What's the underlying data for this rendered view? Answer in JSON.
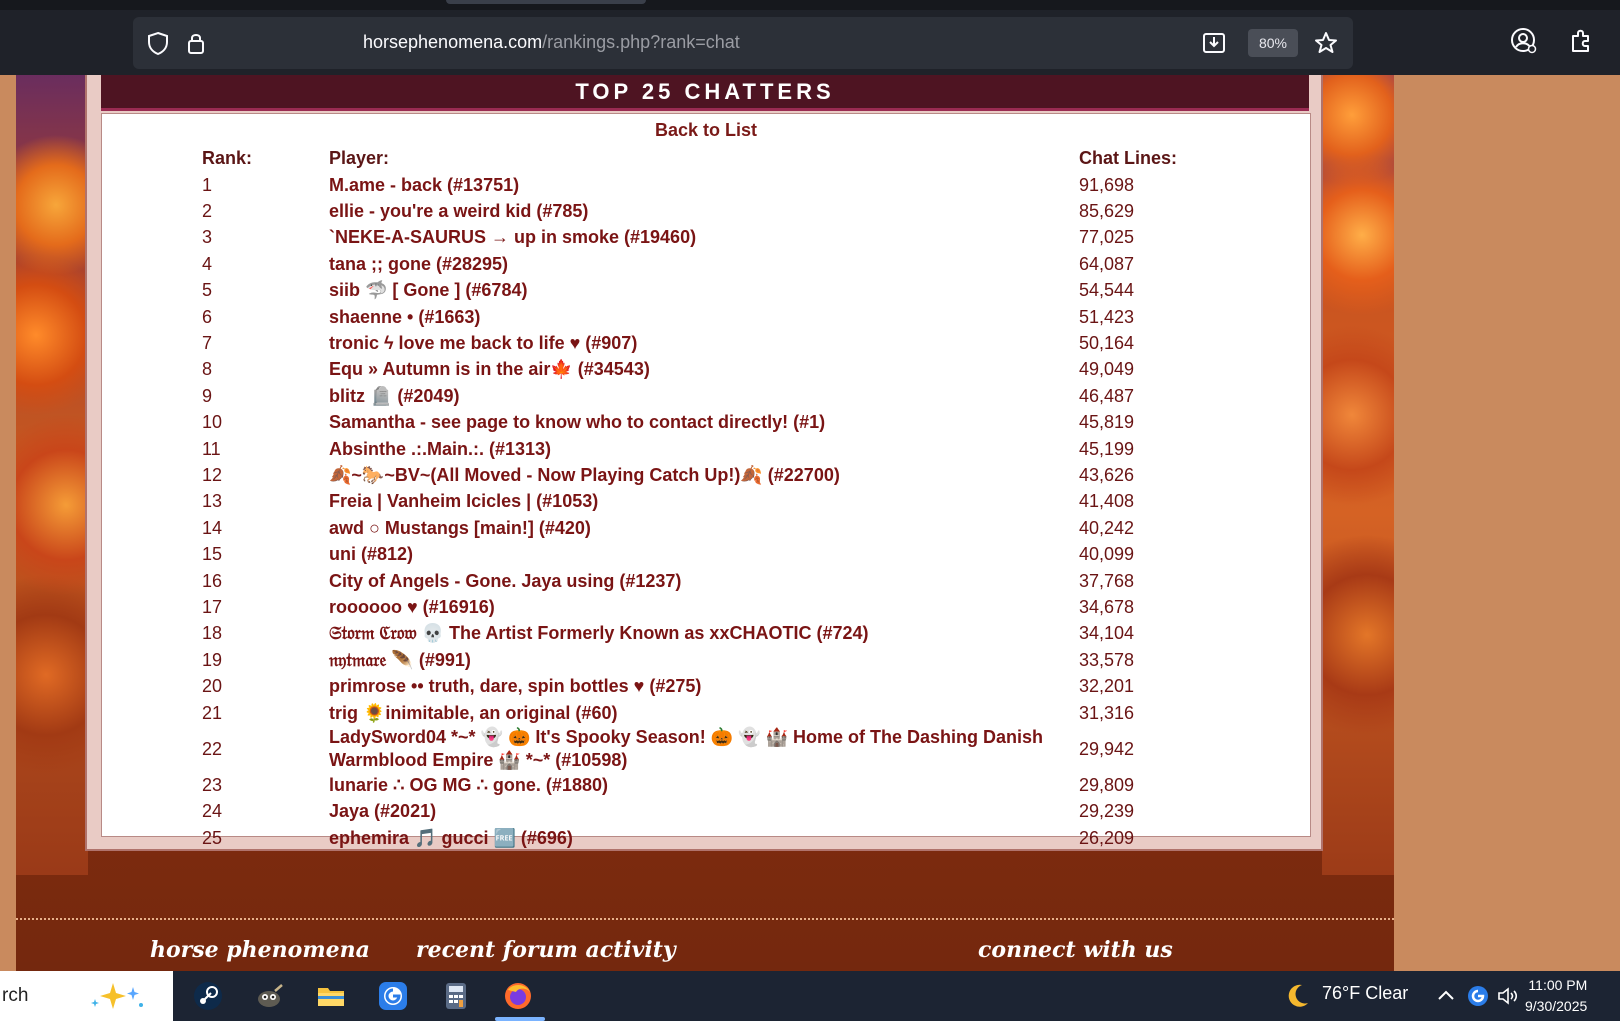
{
  "browser": {
    "url_host": "horsephenomena.com",
    "url_path": "/rankings.php?rank=chat",
    "zoom": "80%"
  },
  "panel": {
    "title": "TOP 25 CHATTERS",
    "back_link": "Back to List",
    "headers": {
      "rank": "Rank:",
      "player": "Player:",
      "lines": "Chat Lines:"
    },
    "rows": [
      {
        "rank": "1",
        "player": "M.ame - back (#13751)",
        "lines": "91,698"
      },
      {
        "rank": "2",
        "player": "ellie - you're a weird kid (#785)",
        "lines": "85,629"
      },
      {
        "rank": "3",
        "player": "`NEKE-A-SAURUS → up in smoke (#19460)",
        "lines": "77,025"
      },
      {
        "rank": "4",
        "player": "tana ;; gone (#28295)",
        "lines": "64,087"
      },
      {
        "rank": "5",
        "player": "siib 🦈 [ Gone ] (#6784)",
        "lines": "54,544"
      },
      {
        "rank": "6",
        "player": "shaenne • (#1663)",
        "lines": "51,423"
      },
      {
        "rank": "7",
        "player": "tronic ϟ love me back to life ♥ (#907)",
        "lines": "50,164"
      },
      {
        "rank": "8",
        "player": "Equ » Autumn is in the air🍁 (#34543)",
        "lines": "49,049"
      },
      {
        "rank": "9",
        "player": "blitz 🪦 (#2049)",
        "lines": "46,487"
      },
      {
        "rank": "10",
        "player": "Samantha - see page to know who to contact directly! (#1)",
        "lines": "45,819"
      },
      {
        "rank": "11",
        "player": "Absinthe .:.Main.:. (#1313)",
        "lines": "45,199"
      },
      {
        "rank": "12",
        "player": "🍂~🐎~BV~(All Moved - Now Playing Catch Up!)🍂 (#22700)",
        "lines": "43,626"
      },
      {
        "rank": "13",
        "player": "Freia | Vanheim Icicles | (#1053)",
        "lines": "41,408"
      },
      {
        "rank": "14",
        "player": "awd ○ Mustangs [main!] (#420)",
        "lines": "40,242"
      },
      {
        "rank": "15",
        "player": "uni (#812)",
        "lines": "40,099"
      },
      {
        "rank": "16",
        "player": "City of Angels - Gone. Jaya using (#1237)",
        "lines": "37,768"
      },
      {
        "rank": "17",
        "player": "roooooo ♥ (#16916)",
        "lines": "34,678"
      },
      {
        "rank": "18",
        "player": "𝔖𝔱𝔬𝔯𝔪 ℭ𝔯𝔬𝔴 💀 The Artist Formerly Known as xxCHAOTIC (#724)",
        "lines": "34,104"
      },
      {
        "rank": "19",
        "player": "𝔫𝔶𝔱𝔪𝔞𝔯𝔢 🪶 (#991)",
        "lines": "33,578"
      },
      {
        "rank": "20",
        "player": "primrose •• truth, dare, spin bottles ♥ (#275)",
        "lines": "32,201"
      },
      {
        "rank": "21",
        "player": "trig 🌻inimitable, an original (#60)",
        "lines": "31,316"
      },
      {
        "rank": "22",
        "player": "LadySword04 *~* 👻 🎃 It's Spooky Season! 🎃 👻 🏰 Home of The Dashing Danish Warmblood Empire 🏰 *~* (#10598)",
        "lines": "29,942"
      },
      {
        "rank": "23",
        "player": "lunarie ∴ OG MG ∴ gone. (#1880)",
        "lines": "29,809"
      },
      {
        "rank": "24",
        "player": "Jaya (#2021)",
        "lines": "29,239"
      },
      {
        "rank": "25",
        "player": "ephemira 🎵 gucci 🆓 (#696)",
        "lines": "26,209"
      }
    ]
  },
  "footer": {
    "col1": "horse phenomena",
    "col2": "recent forum activity",
    "col3": "connect with us"
  },
  "taskbar": {
    "search_text": "rch",
    "weather": "76°F  Clear",
    "time": "11:00 PM",
    "date": "9/30/2025"
  }
}
